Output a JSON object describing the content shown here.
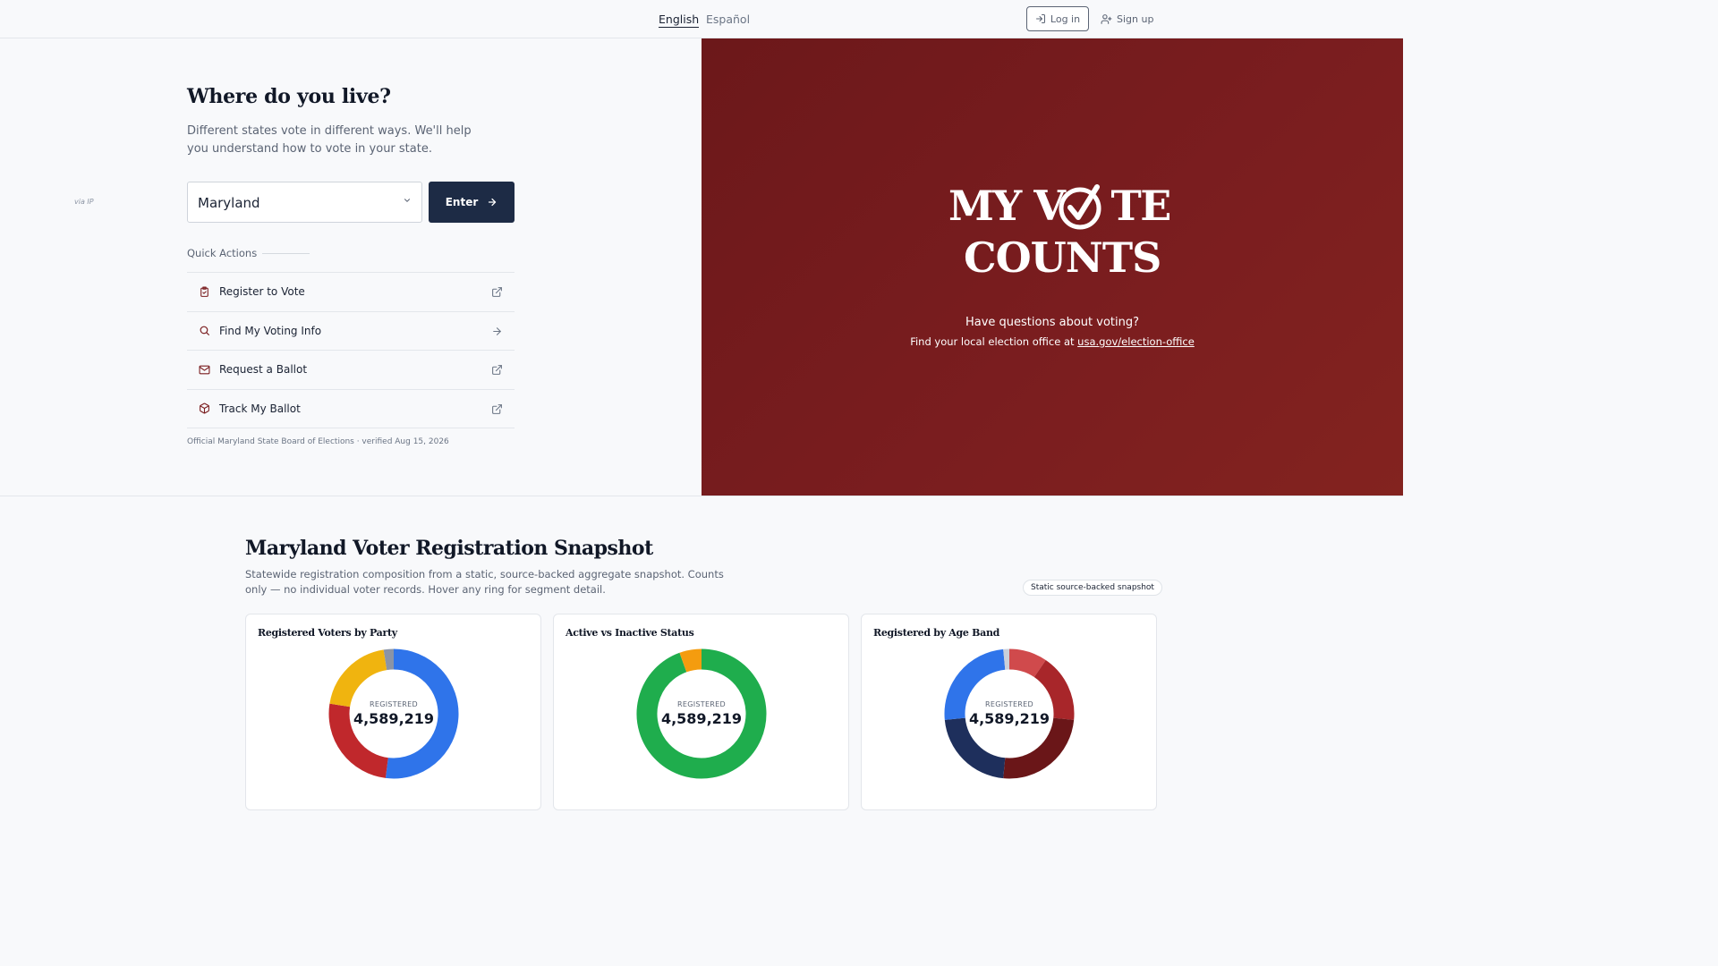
{
  "header": {
    "lang_en": "English",
    "lang_es": "Español",
    "login_label": "Log in",
    "signup_label": "Sign up"
  },
  "hero": {
    "title": "Where do you live?",
    "lead": "Different states vote in different ways. We'll help you understand how to vote in your state.",
    "state_select": {
      "value": "Maryland",
      "hint": "via IP"
    },
    "enter_label": "Enter",
    "quick_actions_title": "Quick Actions",
    "quick_actions": [
      {
        "label": "Register to Vote",
        "icon": "clipboard-check-icon",
        "trailing": "external-link-icon"
      },
      {
        "label": "Find My Voting Info",
        "icon": "search-icon",
        "trailing": "arrow-right-icon"
      },
      {
        "label": "Request a Ballot",
        "icon": "mail-icon",
        "trailing": "external-link-icon"
      },
      {
        "label": "Track My Ballot",
        "icon": "package-icon",
        "trailing": "external-link-icon"
      }
    ],
    "verified_note": "Official Maryland State Board of Elections · verified Aug 15, 2026"
  },
  "brand": {
    "line1_left": "MY V",
    "line1_right": "TE",
    "line2": "COUNTS",
    "questions": "Have questions about voting?",
    "office_text": "Find your local election office at ",
    "office_link": "usa.gov/election-office",
    "color": "#7a1d1f"
  },
  "snapshot": {
    "title": "Maryland Voter Registration Snapshot",
    "description": "Statewide registration composition from a static, source-backed aggregate snapshot. Counts only — no individual voter records. Hover any ring for segment detail.",
    "badge": "Static source-backed snapshot"
  },
  "chart_data": [
    {
      "type": "pie",
      "title": "Registered Voters by Party",
      "center_label": "REGISTERED",
      "center_value": "4,589,219",
      "slices": [
        {
          "value": 0.52,
          "color": "#2f74ea"
        },
        {
          "value": 0.255,
          "color": "#c0282c"
        },
        {
          "value": 0.2,
          "color": "#f0b40f"
        },
        {
          "value": 0.025,
          "color": "#8a94a6"
        }
      ]
    },
    {
      "type": "pie",
      "title": "Active vs Inactive Status",
      "center_label": "REGISTERED",
      "center_value": "4,589,219",
      "slices": [
        {
          "value": 0.945,
          "color": "#1fad4d"
        },
        {
          "value": 0.055,
          "color": "#f49c0f"
        }
      ]
    },
    {
      "type": "pie",
      "title": "Registered by Age Band",
      "center_label": "REGISTERED",
      "center_value": "4,589,219",
      "slices": [
        {
          "value": 0.095,
          "color": "#d04a4c"
        },
        {
          "value": 0.17,
          "color": "#a8262a"
        },
        {
          "value": 0.25,
          "color": "#6a1618"
        },
        {
          "value": 0.22,
          "color": "#1e2f5c"
        },
        {
          "value": 0.25,
          "color": "#2f74ea"
        },
        {
          "value": 0.015,
          "color": "#c9cfda"
        }
      ]
    }
  ]
}
